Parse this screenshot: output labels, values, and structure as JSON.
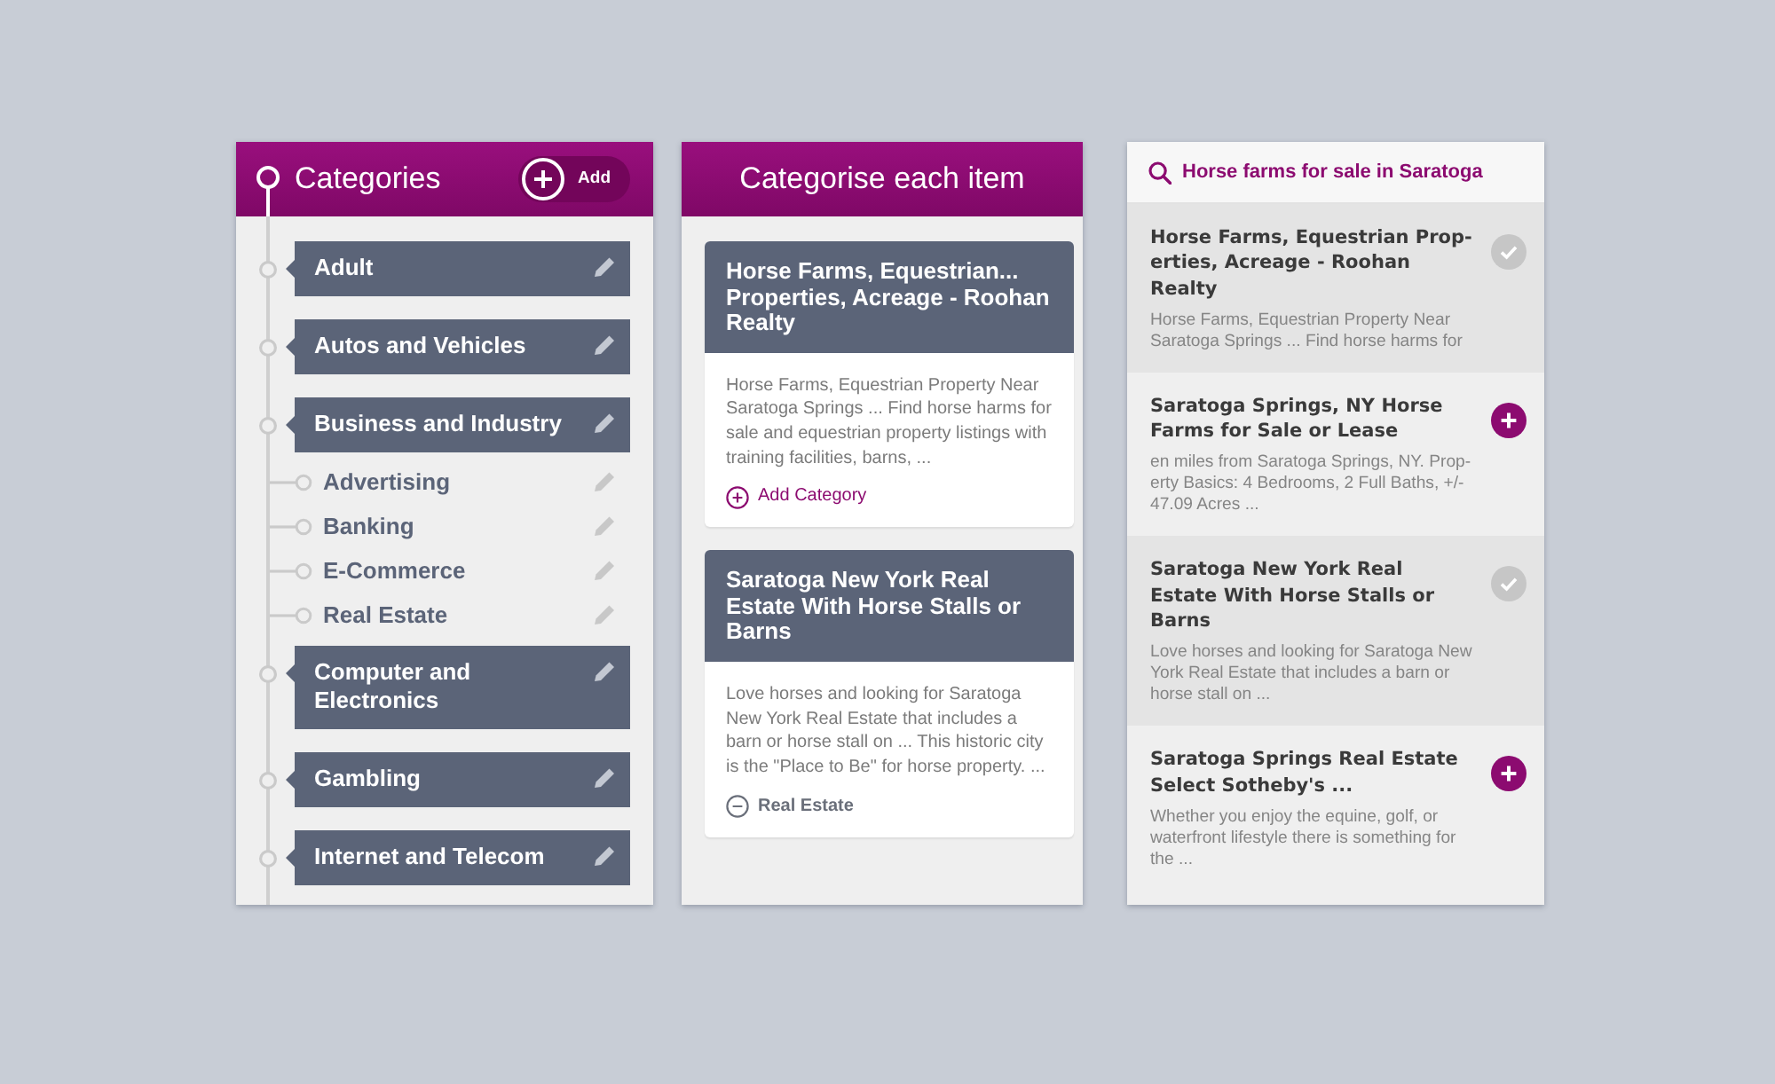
{
  "categories_panel": {
    "title": "Categories",
    "add_button": "Add",
    "items": [
      {
        "label": "Adult"
      },
      {
        "label": "Autos and Vehicles"
      },
      {
        "label": "Business and Industry",
        "children": [
          {
            "label": "Advertising"
          },
          {
            "label": "Banking"
          },
          {
            "label": "E-Commerce"
          },
          {
            "label": "Real Estate"
          }
        ]
      },
      {
        "label": "Computer and Electronics"
      },
      {
        "label": "Gambling"
      },
      {
        "label": "Internet and Telecom"
      }
    ]
  },
  "items_panel": {
    "title": "Categorise each item",
    "cards": [
      {
        "title": "Horse Farms, Equestrian... Properties, Acreage - Roohan Realty",
        "snippet": "Horse Farms, Equestrian Property Near Saratoga Springs ... Find horse harms for sale and equestrian property listings with training facilities, barns, ...",
        "action": {
          "kind": "add",
          "label": "Add Category"
        }
      },
      {
        "title": "Saratoga New York Real Estate With Horse Stalls or Barns",
        "snippet": "Love horses and looking for Saratoga New York Real Estate that includes a barn or horse stall on ... This historic city is the \"Place to Be\" for horse property. ...",
        "action": {
          "kind": "assigned",
          "label": "Real Estate"
        }
      }
    ]
  },
  "search_panel": {
    "search": {
      "value": "Horse farms for sale in Saratoga"
    },
    "results": [
      {
        "title": "Horse Farms, Equestrian Prop-erties, Acreage - Roohan Realty",
        "snippet": "Horse Farms, Equestrian Property Near Saratoga Springs ... Find horse harms for",
        "added": true
      },
      {
        "title": "Saratoga Springs, NY Horse Farms for Sale or Lease",
        "snippet": "en miles from Saratoga Springs, NY. Prop-erty Basics: 4 Bedrooms, 2 Full Baths, +/- 47.09 Acres ...",
        "added": false
      },
      {
        "title": "Saratoga New York Real Estate With Horse Stalls or Barns",
        "snippet": "Love horses and looking for Saratoga New York Real Estate that includes a barn or horse stall on ...",
        "added": true
      },
      {
        "title": "Saratoga Springs Real Estate Select Sotheby's ...",
        "snippet": "Whether you enjoy the equine, golf, or waterfront lifestyle there is something for the ...",
        "added": false
      }
    ]
  }
}
